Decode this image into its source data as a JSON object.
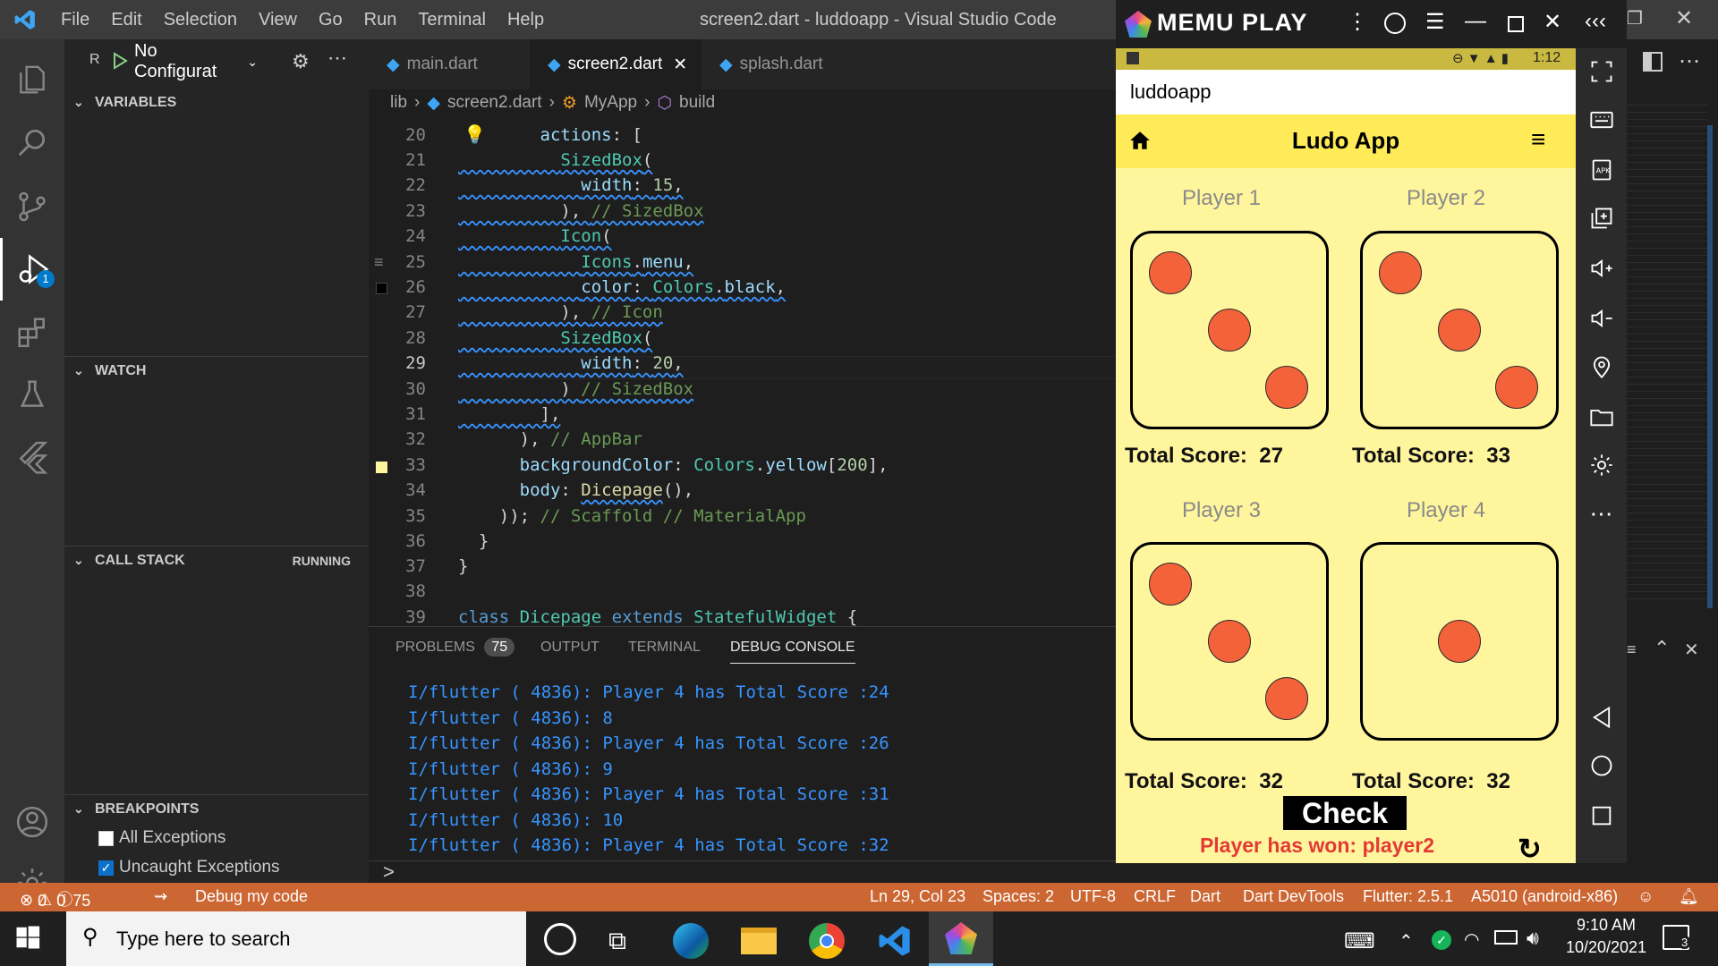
{
  "titlebar": {
    "menu": [
      "File",
      "Edit",
      "Selection",
      "View",
      "Go",
      "Run",
      "Terminal",
      "Help"
    ],
    "window_title": "screen2.dart - luddoapp - Visual Studio Code"
  },
  "debug": {
    "run_letter": "R",
    "config_label": "No Configurat",
    "debug_badge": "1"
  },
  "sidebar": {
    "variables": "VARIABLES",
    "watch": "WATCH",
    "call_stack": "CALL STACK",
    "call_stack_state": "RUNNING",
    "breakpoints": "BREAKPOINTS",
    "bp_items": [
      {
        "label": "All Exceptions",
        "checked": false
      },
      {
        "label": "Uncaught Exceptions",
        "checked": true
      }
    ]
  },
  "tabs": [
    {
      "label": "main.dart",
      "active": false
    },
    {
      "label": "screen2.dart",
      "active": true
    },
    {
      "label": "splash.dart",
      "active": false
    }
  ],
  "breadcrumb": [
    "lib",
    "screen2.dart",
    "MyApp",
    "build"
  ],
  "code": {
    "line_numbers": [
      "20",
      "21",
      "22",
      "23",
      "24",
      "25",
      "26",
      "27",
      "28",
      "29",
      "30",
      "31",
      "32",
      "33",
      "34",
      "35",
      "36",
      "37",
      "38",
      "39"
    ],
    "current_line": "29"
  },
  "panel": {
    "tabs": [
      "PROBLEMS",
      "OUTPUT",
      "TERMINAL",
      "DEBUG CONSOLE"
    ],
    "problems_count": "75",
    "active_tab": "DEBUG CONSOLE",
    "console_lines": [
      "I/flutter ( 4836): Player 4 has Total Score :24",
      "I/flutter ( 4836): 8",
      "I/flutter ( 4836): Player 4 has Total Score :26",
      "I/flutter ( 4836): 9",
      "I/flutter ( 4836): Player 4 has Total Score :31",
      "I/flutter ( 4836): 10",
      "I/flutter ( 4836): Player 4 has Total Score :32"
    ],
    "prompt": ">"
  },
  "statusbar": {
    "errors": "0",
    "warnings": "0",
    "infos": "75",
    "debug": "Debug my code",
    "position": "Ln 29, Col 23",
    "spaces": "Spaces: 2",
    "encoding": "UTF-8",
    "eol": "CRLF",
    "language": "Dart",
    "devtools": "Dart DevTools",
    "flutter": "Flutter: 2.5.1",
    "device": "A5010 (android-x86)"
  },
  "taskbar": {
    "search_placeholder": "Type here to search",
    "time": "9:10 AM",
    "date": "10/20/2021",
    "notif_count": "3"
  },
  "memu": {
    "brand": "MEMU PLAY",
    "phone_time": "1:12",
    "app_title": "luddoapp",
    "ludo_title": "Ludo App",
    "players": [
      {
        "name": "Player 1",
        "score_label": "Total Score:",
        "score": "27",
        "dots": 3
      },
      {
        "name": "Player 2",
        "score_label": "Total Score:",
        "score": "33",
        "dots": 3
      },
      {
        "name": "Player 3",
        "score_label": "Total Score:",
        "score": "32",
        "dots": 3
      },
      {
        "name": "Player 4",
        "score_label": "Total Score:",
        "score": "32",
        "dots": 1
      }
    ],
    "check_label": "Check",
    "winner_text": "Player has won: player2",
    "colors": {
      "appbar": "#ffeb57",
      "body": "#fff59d",
      "dot": "#f4623a",
      "winner": "#e53935"
    }
  }
}
